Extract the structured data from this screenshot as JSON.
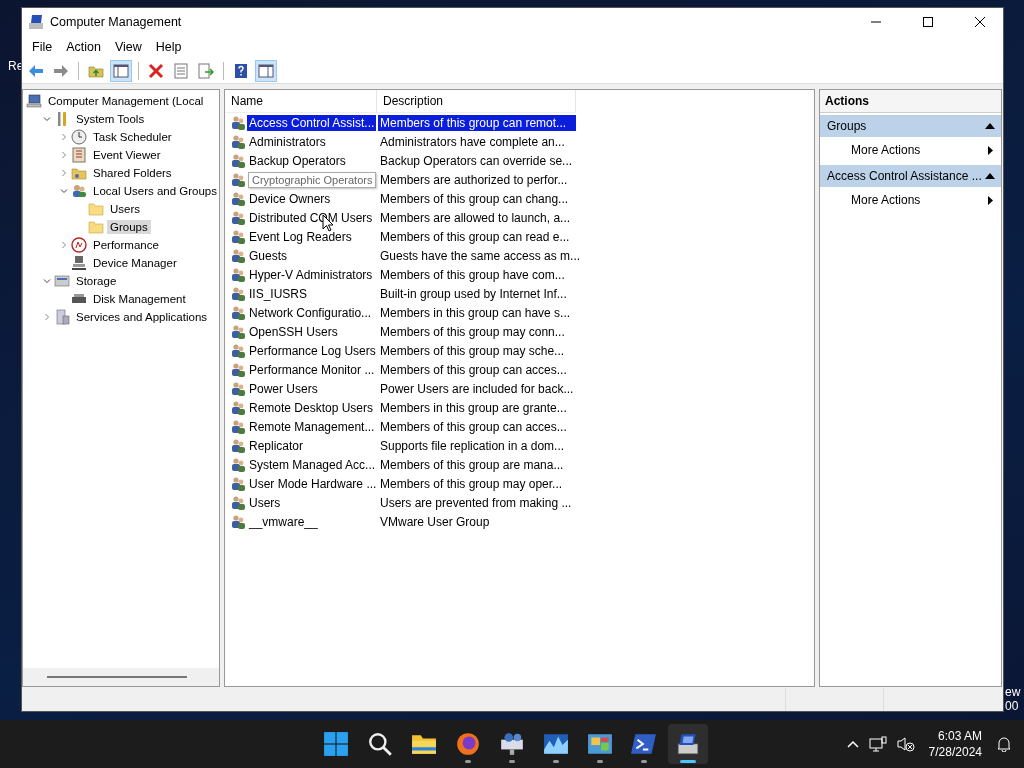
{
  "desktop": {
    "fragments": [
      "Re",
      "ew",
      "00"
    ]
  },
  "window": {
    "title": "Computer Management"
  },
  "menu": [
    "File",
    "Action",
    "View",
    "Help"
  ],
  "toolbar": [
    {
      "kind": "back",
      "pressed": false
    },
    {
      "kind": "forward",
      "pressed": false
    },
    {
      "kind": "sep"
    },
    {
      "kind": "up",
      "pressed": false
    },
    {
      "kind": "tree",
      "pressed": true
    },
    {
      "kind": "sep"
    },
    {
      "kind": "delete",
      "pressed": false
    },
    {
      "kind": "properties",
      "pressed": false
    },
    {
      "kind": "export",
      "pressed": false
    },
    {
      "kind": "sep"
    },
    {
      "kind": "help",
      "pressed": false
    },
    {
      "kind": "pane",
      "pressed": true
    }
  ],
  "tree": [
    {
      "label": "Computer Management (Local",
      "kind": "computer",
      "selected": false,
      "children": [
        {
          "label": "System Tools",
          "kind": "tools",
          "expanded": true,
          "selected": false,
          "children": [
            {
              "label": "Task Scheduler",
              "kind": "clock",
              "expanded": false,
              "selected": false
            },
            {
              "label": "Event Viewer",
              "kind": "log",
              "expanded": false,
              "selected": false
            },
            {
              "label": "Shared Folders",
              "kind": "share",
              "expanded": false,
              "selected": false
            },
            {
              "label": "Local Users and Groups",
              "kind": "users",
              "expanded": true,
              "selected": false,
              "children": [
                {
                  "label": "Users",
                  "kind": "folder",
                  "selected": false
                },
                {
                  "label": "Groups",
                  "kind": "folder",
                  "selected": true
                }
              ]
            },
            {
              "label": "Performance",
              "kind": "gauge",
              "expanded": false,
              "selected": false
            },
            {
              "label": "Device Manager",
              "kind": "device",
              "selected": false
            }
          ]
        },
        {
          "label": "Storage",
          "kind": "storage",
          "expanded": true,
          "selected": false,
          "children": [
            {
              "label": "Disk Management",
              "kind": "disk",
              "selected": false
            }
          ]
        },
        {
          "label": "Services and Applications",
          "kind": "services",
          "expanded": false,
          "selected": false
        }
      ]
    }
  ],
  "table": {
    "columns": [
      "Name",
      "Description"
    ],
    "rows": [
      {
        "name": "Access Control Assist...",
        "description": "Members of this group can remot...",
        "selected": true,
        "tooltip": false
      },
      {
        "name": "Administrators",
        "description": "Administrators have complete an...",
        "selected": false,
        "tooltip": false
      },
      {
        "name": "Backup Operators",
        "description": "Backup Operators can override se...",
        "selected": false,
        "tooltip": false
      },
      {
        "name": "Cryptographic Operators",
        "description": "Members are authorized to perfor...",
        "selected": false,
        "tooltip": true
      },
      {
        "name": "Device Owners",
        "description": "Members of this group can chang...",
        "selected": false,
        "tooltip": false
      },
      {
        "name": "Distributed COM Users",
        "description": "Members are allowed to launch, a...",
        "selected": false,
        "tooltip": false
      },
      {
        "name": "Event Log Readers",
        "description": "Members of this group can read e...",
        "selected": false,
        "tooltip": false
      },
      {
        "name": "Guests",
        "description": "Guests have the same access as m...",
        "selected": false,
        "tooltip": false
      },
      {
        "name": "Hyper-V Administrators",
        "description": "Members of this group have com...",
        "selected": false,
        "tooltip": false
      },
      {
        "name": "IIS_IUSRS",
        "description": "Built-in group used by Internet Inf...",
        "selected": false,
        "tooltip": false
      },
      {
        "name": "Network Configuratio...",
        "description": "Members in this group can have s...",
        "selected": false,
        "tooltip": false
      },
      {
        "name": "OpenSSH Users",
        "description": "Members of this group may conn...",
        "selected": false,
        "tooltip": false
      },
      {
        "name": "Performance Log Users",
        "description": "Members of this group may sche...",
        "selected": false,
        "tooltip": false
      },
      {
        "name": "Performance Monitor ...",
        "description": "Members of this group can acces...",
        "selected": false,
        "tooltip": false
      },
      {
        "name": "Power Users",
        "description": "Power Users are included for back...",
        "selected": false,
        "tooltip": false
      },
      {
        "name": "Remote Desktop Users",
        "description": "Members in this group are grante...",
        "selected": false,
        "tooltip": false
      },
      {
        "name": "Remote Management...",
        "description": "Members of this group can acces...",
        "selected": false,
        "tooltip": false
      },
      {
        "name": "Replicator",
        "description": "Supports file replication in a dom...",
        "selected": false,
        "tooltip": false
      },
      {
        "name": "System Managed Acc...",
        "description": "Members of this group are mana...",
        "selected": false,
        "tooltip": false
      },
      {
        "name": "User Mode Hardware ...",
        "description": "Members of this group may oper...",
        "selected": false,
        "tooltip": false
      },
      {
        "name": "Users",
        "description": "Users are prevented from making ...",
        "selected": false,
        "tooltip": false
      },
      {
        "name": "__vmware__",
        "description": "VMware User Group",
        "selected": false,
        "tooltip": false
      }
    ]
  },
  "actions": {
    "title": "Actions",
    "sections": [
      {
        "title": "Groups",
        "expanded": true,
        "items": [
          "More Actions"
        ]
      },
      {
        "title": "Access Control Assistance ...",
        "expanded": true,
        "items": [
          "More Actions"
        ]
      }
    ]
  },
  "taskbar": {
    "apps": [
      {
        "kind": "start",
        "running": false,
        "selected": false
      },
      {
        "kind": "search",
        "running": false,
        "selected": false
      },
      {
        "kind": "folder",
        "running": false,
        "selected": false
      },
      {
        "kind": "browser",
        "running": true,
        "selected": false
      },
      {
        "kind": "network",
        "running": true,
        "selected": false
      },
      {
        "kind": "chart",
        "running": true,
        "selected": false
      },
      {
        "kind": "panel",
        "running": true,
        "selected": false
      },
      {
        "kind": "shell",
        "running": true,
        "selected": false
      },
      {
        "kind": "manager",
        "running": true,
        "selected": true
      }
    ],
    "clock": {
      "time": "6:03 AM",
      "date": "7/28/2024"
    }
  }
}
